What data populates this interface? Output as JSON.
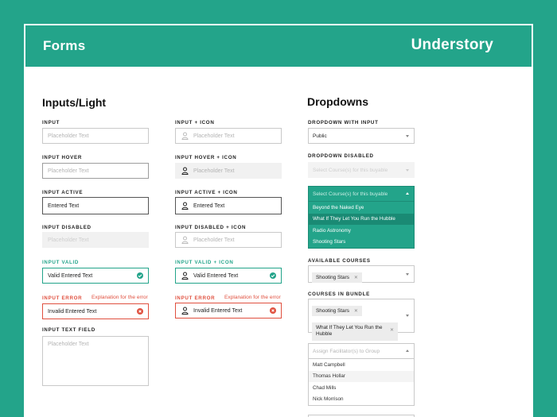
{
  "header": {
    "title": "Forms",
    "brand": "Understory"
  },
  "inputs_section": {
    "title": "Inputs/Light",
    "col1": {
      "input_label": "INPUT",
      "input_placeholder": "Placeholder Text",
      "hover_label": "INPUT HOVER",
      "hover_placeholder": "Placeholder Text",
      "active_label": "INPUT ACTIVE",
      "active_value": "Entered Text",
      "disabled_label": "INPUT DISABLED",
      "disabled_placeholder": "Placeholder Text",
      "valid_label": "INPUT VALID",
      "valid_value": "Valid Entered Text",
      "error_label": "INPUT ERROR",
      "error_message": "Explanation for the error",
      "error_value": "Invalid Entered Text",
      "textfield_label": "INPUT TEXT FIELD",
      "textfield_placeholder": "Placeholder Text"
    },
    "col2": {
      "input_label": "INPUT + ICON",
      "input_placeholder": "Placeholder Text",
      "hover_label": "INPUT HOVER + ICON",
      "hover_placeholder": "Placeholder Text",
      "active_label": "INPUT ACTIVE + ICON",
      "active_value": "Entered Text",
      "disabled_label": "INPUT DISABLED + ICON",
      "disabled_placeholder": "Placeholder Text",
      "valid_label": "INPUT VALID + ICON",
      "valid_value": "Valid Entered Text",
      "error_label": "INPUT ERROR",
      "error_message": "Explanation for the error",
      "error_value": "Invalid Entered Text"
    }
  },
  "dropdowns_section": {
    "title": "Dropdowns",
    "with_input_label": "DROPDOWN WITH INPUT",
    "with_input_value": "Public",
    "disabled_label": "DROPDOWN DISABLED",
    "disabled_placeholder": "Select Course(s) for this buyable",
    "open_placeholder": "Select Course(s) for this buyable",
    "open_options": [
      "Beyond the Naked Eye",
      "What If They Let You Run the Hubble",
      "Radio Astronomy",
      "Shooting Stars"
    ],
    "available_label": "AVAILABLE COURSES",
    "available_chips": [
      "Shooting Stars"
    ],
    "bundle_label": "COURSES IN BUNDLE",
    "bundle_chips": [
      "Shooting Stars",
      "What If They Let You Run the Hubble"
    ],
    "facilitator_placeholder": "Assign Facilitator(s) to Group",
    "facilitator_options": [
      "Matt Campbell",
      "Thomas Hollar",
      "Chad Mills",
      "Nick Morrison"
    ]
  },
  "colors": {
    "brand_green": "#23a48a",
    "error_red": "#e0503f"
  },
  "icons": {
    "field_icon": "user-icon",
    "valid_icon": "check-circle-icon",
    "error_icon": "x-circle-icon",
    "dropdown_icon": "chevron-down-icon",
    "chip_remove_icon": "close-icon"
  }
}
